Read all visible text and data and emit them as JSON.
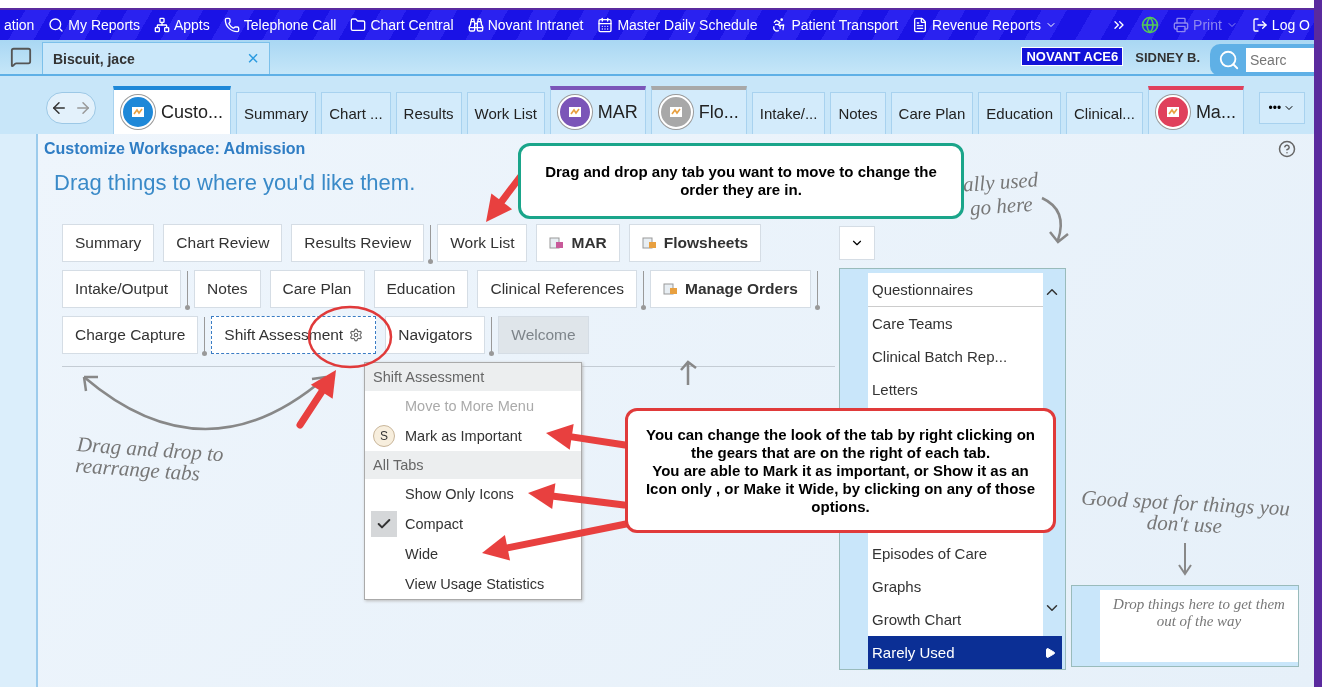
{
  "toolbar": {
    "items": [
      {
        "label": "ation",
        "disabled": false,
        "dropdown": false
      },
      {
        "label": "My Reports",
        "disabled": false,
        "dropdown": false
      },
      {
        "label": "Appts",
        "disabled": false,
        "dropdown": false
      },
      {
        "label": "Telephone Call",
        "disabled": false,
        "dropdown": false
      },
      {
        "label": "Chart Central",
        "disabled": false,
        "dropdown": false
      },
      {
        "label": "Novant Intranet",
        "disabled": false,
        "dropdown": false
      },
      {
        "label": "Master Daily Schedule",
        "disabled": false,
        "dropdown": false
      },
      {
        "label": "Patient Transport",
        "disabled": false,
        "dropdown": false
      },
      {
        "label": "Revenue Reports",
        "disabled": false,
        "dropdown": true
      }
    ],
    "right_items": [
      {
        "label": "Print",
        "disabled": true,
        "dropdown": true
      },
      {
        "label": "Log O",
        "disabled": false,
        "dropdown": false
      }
    ]
  },
  "patient_bar": {
    "patient_tab": "Biscuit, jace",
    "close": "×",
    "department": "NOVANT ACE6",
    "user": "SIDNEY B.",
    "search": {
      "placeholder": "Searc"
    }
  },
  "activity_tabs": [
    {
      "label": "Custo...",
      "selected": true,
      "kind": "icon",
      "color": "#1e88d8"
    },
    {
      "label": "Summary",
      "selected": false,
      "kind": "plain"
    },
    {
      "label": "Chart ...",
      "selected": false,
      "kind": "plain"
    },
    {
      "label": "Results",
      "selected": false,
      "kind": "plain"
    },
    {
      "label": "Work List",
      "selected": false,
      "kind": "plain"
    },
    {
      "label": "MAR",
      "selected": false,
      "kind": "icon",
      "color": "#7b55b8"
    },
    {
      "label": "Flo...",
      "selected": false,
      "kind": "icon",
      "color": "#a8a8a8"
    },
    {
      "label": "Intake/...",
      "selected": false,
      "kind": "plain"
    },
    {
      "label": "Notes",
      "selected": false,
      "kind": "plain"
    },
    {
      "label": "Care Plan",
      "selected": false,
      "kind": "plain"
    },
    {
      "label": "Education",
      "selected": false,
      "kind": "plain"
    },
    {
      "label": "Clinical...",
      "selected": false,
      "kind": "plain"
    },
    {
      "label": "Ma...",
      "selected": false,
      "kind": "icon",
      "color": "#e0405c"
    }
  ],
  "more_tabs": "•••",
  "workspace": {
    "title": "Customize Workspace: Admission",
    "subtitle": "Drag things to where you'd like them.",
    "tab_rows": [
      [
        {
          "label": "Summary",
          "important": false,
          "selected": false,
          "disabled": false,
          "group_end": false
        },
        {
          "label": "Chart Review",
          "important": false,
          "selected": false,
          "disabled": false,
          "group_end": false
        },
        {
          "label": "Results Review",
          "important": false,
          "selected": false,
          "disabled": false,
          "group_end": true
        },
        {
          "label": "Work List",
          "important": false,
          "selected": false,
          "disabled": false,
          "group_end": false
        },
        {
          "label": "MAR",
          "important": true,
          "selected": false,
          "disabled": false,
          "group_end": false
        },
        {
          "label": "Flowsheets",
          "important": true,
          "selected": false,
          "disabled": false,
          "group_end": false
        }
      ],
      [
        {
          "label": "Intake/Output",
          "important": false,
          "selected": false,
          "disabled": false,
          "group_end": true
        },
        {
          "label": "Notes",
          "important": false,
          "selected": false,
          "disabled": false,
          "group_end": false
        },
        {
          "label": "Care Plan",
          "important": false,
          "selected": false,
          "disabled": false,
          "group_end": false
        },
        {
          "label": "Education",
          "important": false,
          "selected": false,
          "disabled": false,
          "group_end": false
        },
        {
          "label": "Clinical References",
          "important": false,
          "selected": false,
          "disabled": false,
          "group_end": true
        },
        {
          "label": "Manage Orders",
          "important": true,
          "selected": false,
          "disabled": false,
          "group_end": true
        }
      ],
      [
        {
          "label": "Charge Capture",
          "important": false,
          "selected": false,
          "disabled": false,
          "group_end": true
        },
        {
          "label": "Shift Assessment",
          "important": false,
          "selected": true,
          "disabled": false,
          "group_end": false
        },
        {
          "label": "Navigators",
          "important": false,
          "selected": false,
          "disabled": false,
          "group_end": true
        },
        {
          "label": "Welcome",
          "important": false,
          "selected": false,
          "disabled": true,
          "group_end": false
        }
      ]
    ],
    "hint_rearrange": "Drag and drop to rearrange tabs",
    "hint_used": [
      "ally used",
      "go here"
    ],
    "hint_unused": "Good spot for things you don't use",
    "drop_box": "Drop things here to get them out of the way",
    "menu_list": {
      "top_items": [
        {
          "label": "Questionnaires",
          "selected": true
        },
        {
          "label": "Care Teams",
          "selected": false
        },
        {
          "label": "Clinical Batch Rep...",
          "selected": false
        },
        {
          "label": "Letters",
          "selected": false
        }
      ],
      "bottom_items": [
        {
          "label": "Episodes of Care",
          "selected": false
        },
        {
          "label": "Graphs",
          "selected": false
        },
        {
          "label": "Growth Chart",
          "selected": false
        }
      ],
      "footer": {
        "label": "Rarely Used",
        "selected": true
      }
    }
  },
  "context_menu": [
    {
      "header": "Shift Assessment",
      "items": [
        {
          "label": "Move to More Menu",
          "disabled": true,
          "checked": false
        },
        {
          "label": "Mark as Important",
          "disabled": false,
          "checked": false,
          "badge": "S"
        }
      ]
    },
    {
      "header": "All Tabs",
      "items": [
        {
          "label": "Show Only Icons",
          "disabled": false,
          "checked": false
        },
        {
          "label": "Compact",
          "disabled": false,
          "checked": true
        },
        {
          "label": "Wide",
          "disabled": false,
          "checked": false
        },
        {
          "label": "View Usage Statistics",
          "disabled": false,
          "checked": false
        }
      ]
    }
  ],
  "callouts": [
    {
      "kind": "green",
      "text": "Drag and drop any tab you want to move to change the order they are in."
    },
    {
      "kind": "red",
      "text": "You can change the look of the tab by  right clicking on the gears that are on the right of each tab.\nYou are able to Mark it as important, or Show it as an Icon only , or Make it Wide, by clicking on any of those options."
    }
  ]
}
